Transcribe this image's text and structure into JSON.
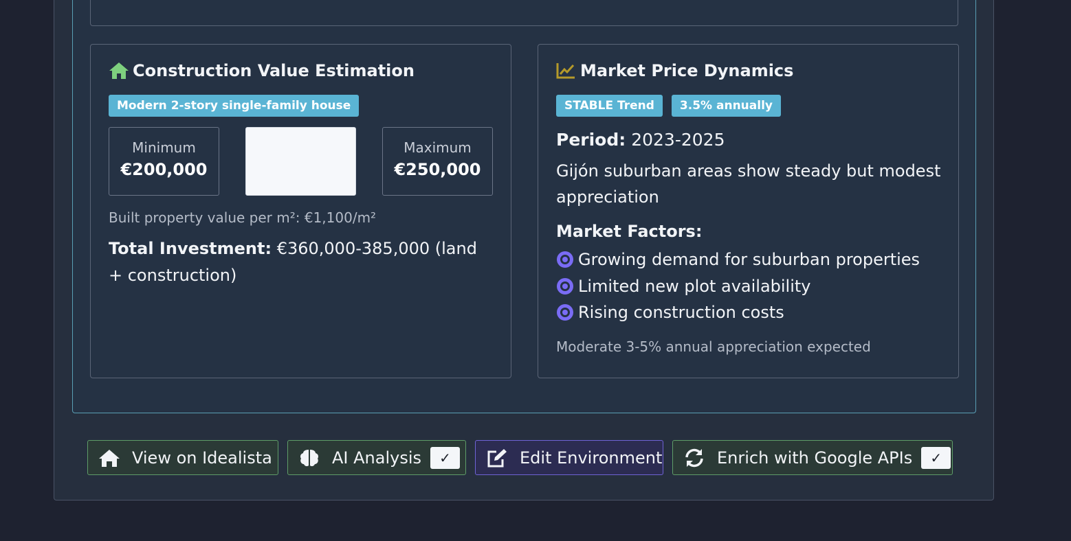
{
  "construction": {
    "title": "Construction Value Estimation",
    "badge": "Modern 2-story single-family house",
    "minimum_label": "Minimum",
    "minimum_value": "€200,000",
    "maximum_label": "Maximum",
    "maximum_value": "€250,000",
    "per_m2": "Built property value per m²: €1,100/m²",
    "total_label": "Total Investment:",
    "total_value": "€360,000-385,000 (land + construction)"
  },
  "market": {
    "title": "Market Price Dynamics",
    "trend_badge": "STABLE Trend",
    "rate_badge": "3.5% annually",
    "period_label": "Period:",
    "period_value": "2023-2025",
    "description": "Gijón suburban areas show steady but modest appreciation",
    "factors_title": "Market Factors:",
    "factors": [
      "Growing demand for suburban properties",
      "Limited new plot availability",
      "Rising construction costs"
    ],
    "expectation": "Moderate 3-5% annual appreciation expected"
  },
  "actions": {
    "idealista": "View on Idealista",
    "ai_analysis": "AI Analysis",
    "ai_check": "✓",
    "edit_env": "Edit Environment",
    "enrich": "Enrich with Google APIs",
    "enrich_check": "✓"
  },
  "colors": {
    "house_icon": "#7ed07e",
    "chart_icon": "#b59a2a",
    "badge": "#5ab4d4",
    "bullet": "#7a6cf5"
  }
}
